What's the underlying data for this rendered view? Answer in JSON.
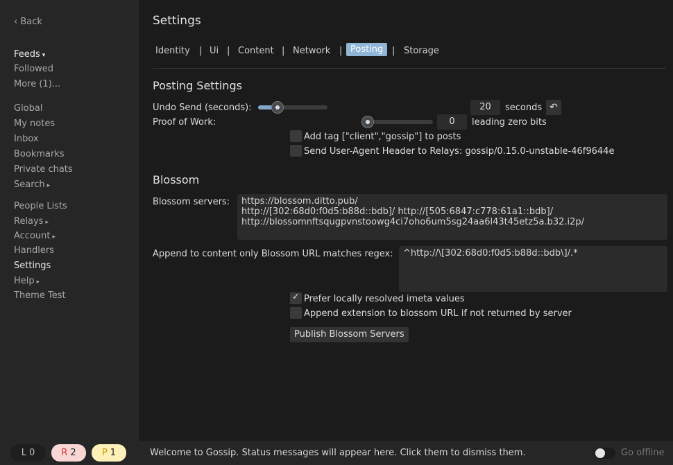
{
  "sidebar": {
    "back": "‹ Back",
    "feeds": "Feeds",
    "feeds_arrow": "▾",
    "followed": "Followed",
    "more": "More (1)...",
    "global": "Global",
    "my_notes": "My notes",
    "inbox": "Inbox",
    "bookmarks": "Bookmarks",
    "private_chats": "Private chats",
    "search": "Search",
    "people_lists": "People Lists",
    "relays": "Relays",
    "account": "Account",
    "handlers": "Handlers",
    "settings": "Settings",
    "help": "Help",
    "theme_test": "Theme Test",
    "submenu_arrow": "▸"
  },
  "header": {
    "title": "Settings"
  },
  "tabs": {
    "identity": "Identity",
    "ui": "Ui",
    "content": "Content",
    "network": "Network",
    "posting": "Posting",
    "storage": "Storage",
    "separator": "|"
  },
  "posting": {
    "heading": "Posting Settings",
    "undo_label": "Undo Send (seconds):",
    "undo_value": "20",
    "undo_unit": "seconds",
    "undo_fraction": 0.22,
    "reset_icon": "↶",
    "pow_label": "Proof of Work:",
    "pow_value": "0",
    "pow_unit": "leading zero bits",
    "pow_fraction": 0.0,
    "add_tag_label": "Add tag [\"client\",\"gossip\"] to posts",
    "user_agent_label": "Send User-Agent Header to Relays: gossip/0.15.0-unstable-46f9644e"
  },
  "blossom": {
    "heading": "Blossom",
    "servers_label": "Blossom servers:",
    "servers_lines": [
      "https://blossom.ditto.pub/",
      "http://[302:68d0:f0d5:b88d::bdb]/ http://[505:6847:c778:61a1::bdb]/",
      "http://blossomnftsqugpvnstoowg4ci7oho6um5sg24aa6l43t45etz5a.b32.i2p/"
    ],
    "regex_label": "Append to content only Blossom URL matches regex:",
    "regex_value": "^http://\\[302:68d0:f0d5:b88d::bdb\\]/.*",
    "prefer_label": "Prefer locally resolved imeta values",
    "prefer_checked": true,
    "append_ext_label": "Append extension to blossom URL if not returned by server",
    "append_ext_checked": false,
    "publish_button": "Publish Blossom Servers"
  },
  "status": {
    "l_key": "L",
    "l_val": "0",
    "r_key": "R",
    "r_val": "2",
    "p_key": "P",
    "p_val": "1",
    "message": "Welcome to Gossip. Status messages will appear here. Click them to dismiss them.",
    "offline_label": "Go offline"
  }
}
